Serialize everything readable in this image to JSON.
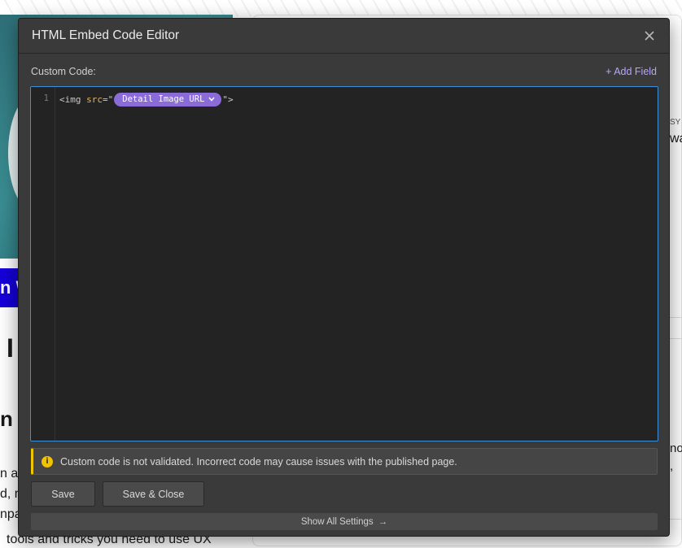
{
  "background": {
    "hero_banner_text": "n W",
    "heading_fragment_1": "I",
    "heading_fragment_2": "n S",
    "para_line_1": "n as",
    "para_line_2": "d, r",
    "para_line_3": "npa",
    "para_line_4": "tools and tricks you need to use UX",
    "right_text_1": "SY S",
    "right_text_2": "wa",
    "right_text_3": "no",
    "right_text_4": ","
  },
  "modal": {
    "title": "HTML Embed Code Editor",
    "close_icon": "close-icon",
    "custom_code_label": "Custom Code:",
    "add_field_label": "+ Add Field",
    "editor": {
      "line_number": "1",
      "code_prefix_tag": "<img ",
      "code_attr": "src",
      "code_eq_quote": "=\"",
      "field_pill_label": "Detail Image URL",
      "code_suffix": "\">"
    },
    "warning_text": "Custom code is not validated. Incorrect code may cause issues with the published page.",
    "warning_icon": "info-icon",
    "accent_color": "#3e8ed8",
    "pill_color": "#8a6bd8",
    "warning_color": "#f1c400",
    "save_label": "Save",
    "save_close_label": "Save & Close",
    "show_all_settings_label": "Show All Settings",
    "show_all_settings_arrow": "→"
  }
}
